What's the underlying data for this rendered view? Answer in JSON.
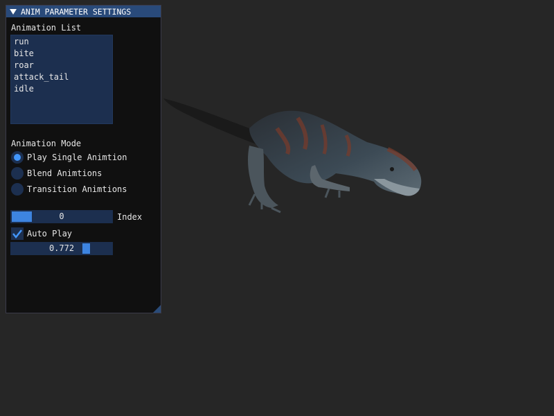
{
  "panel": {
    "title": "ANIM PARAMETER SETTINGS",
    "collapse_icon": "triangle-down-icon",
    "animation_list": {
      "label": "Animation List",
      "items": [
        "run",
        "bite",
        "roar",
        "attack_tail",
        "idle"
      ]
    },
    "animation_mode": {
      "label": "Animation Mode",
      "options": [
        {
          "label": "Play Single Animtion",
          "selected": true
        },
        {
          "label": "Blend Animtions",
          "selected": false
        },
        {
          "label": "Transition Animtions",
          "selected": false
        }
      ]
    },
    "index_slider": {
      "value": "0",
      "label": "Index"
    },
    "auto_play": {
      "label": "Auto Play",
      "checked": true
    },
    "speed_slider": {
      "value": "0.772"
    }
  },
  "scene": {
    "subject": "t-rex-model"
  },
  "colors": {
    "title_bar": "#294a7a",
    "frame_bg": "#1c2f4f",
    "accent": "#4296fa",
    "background": "#262626"
  }
}
